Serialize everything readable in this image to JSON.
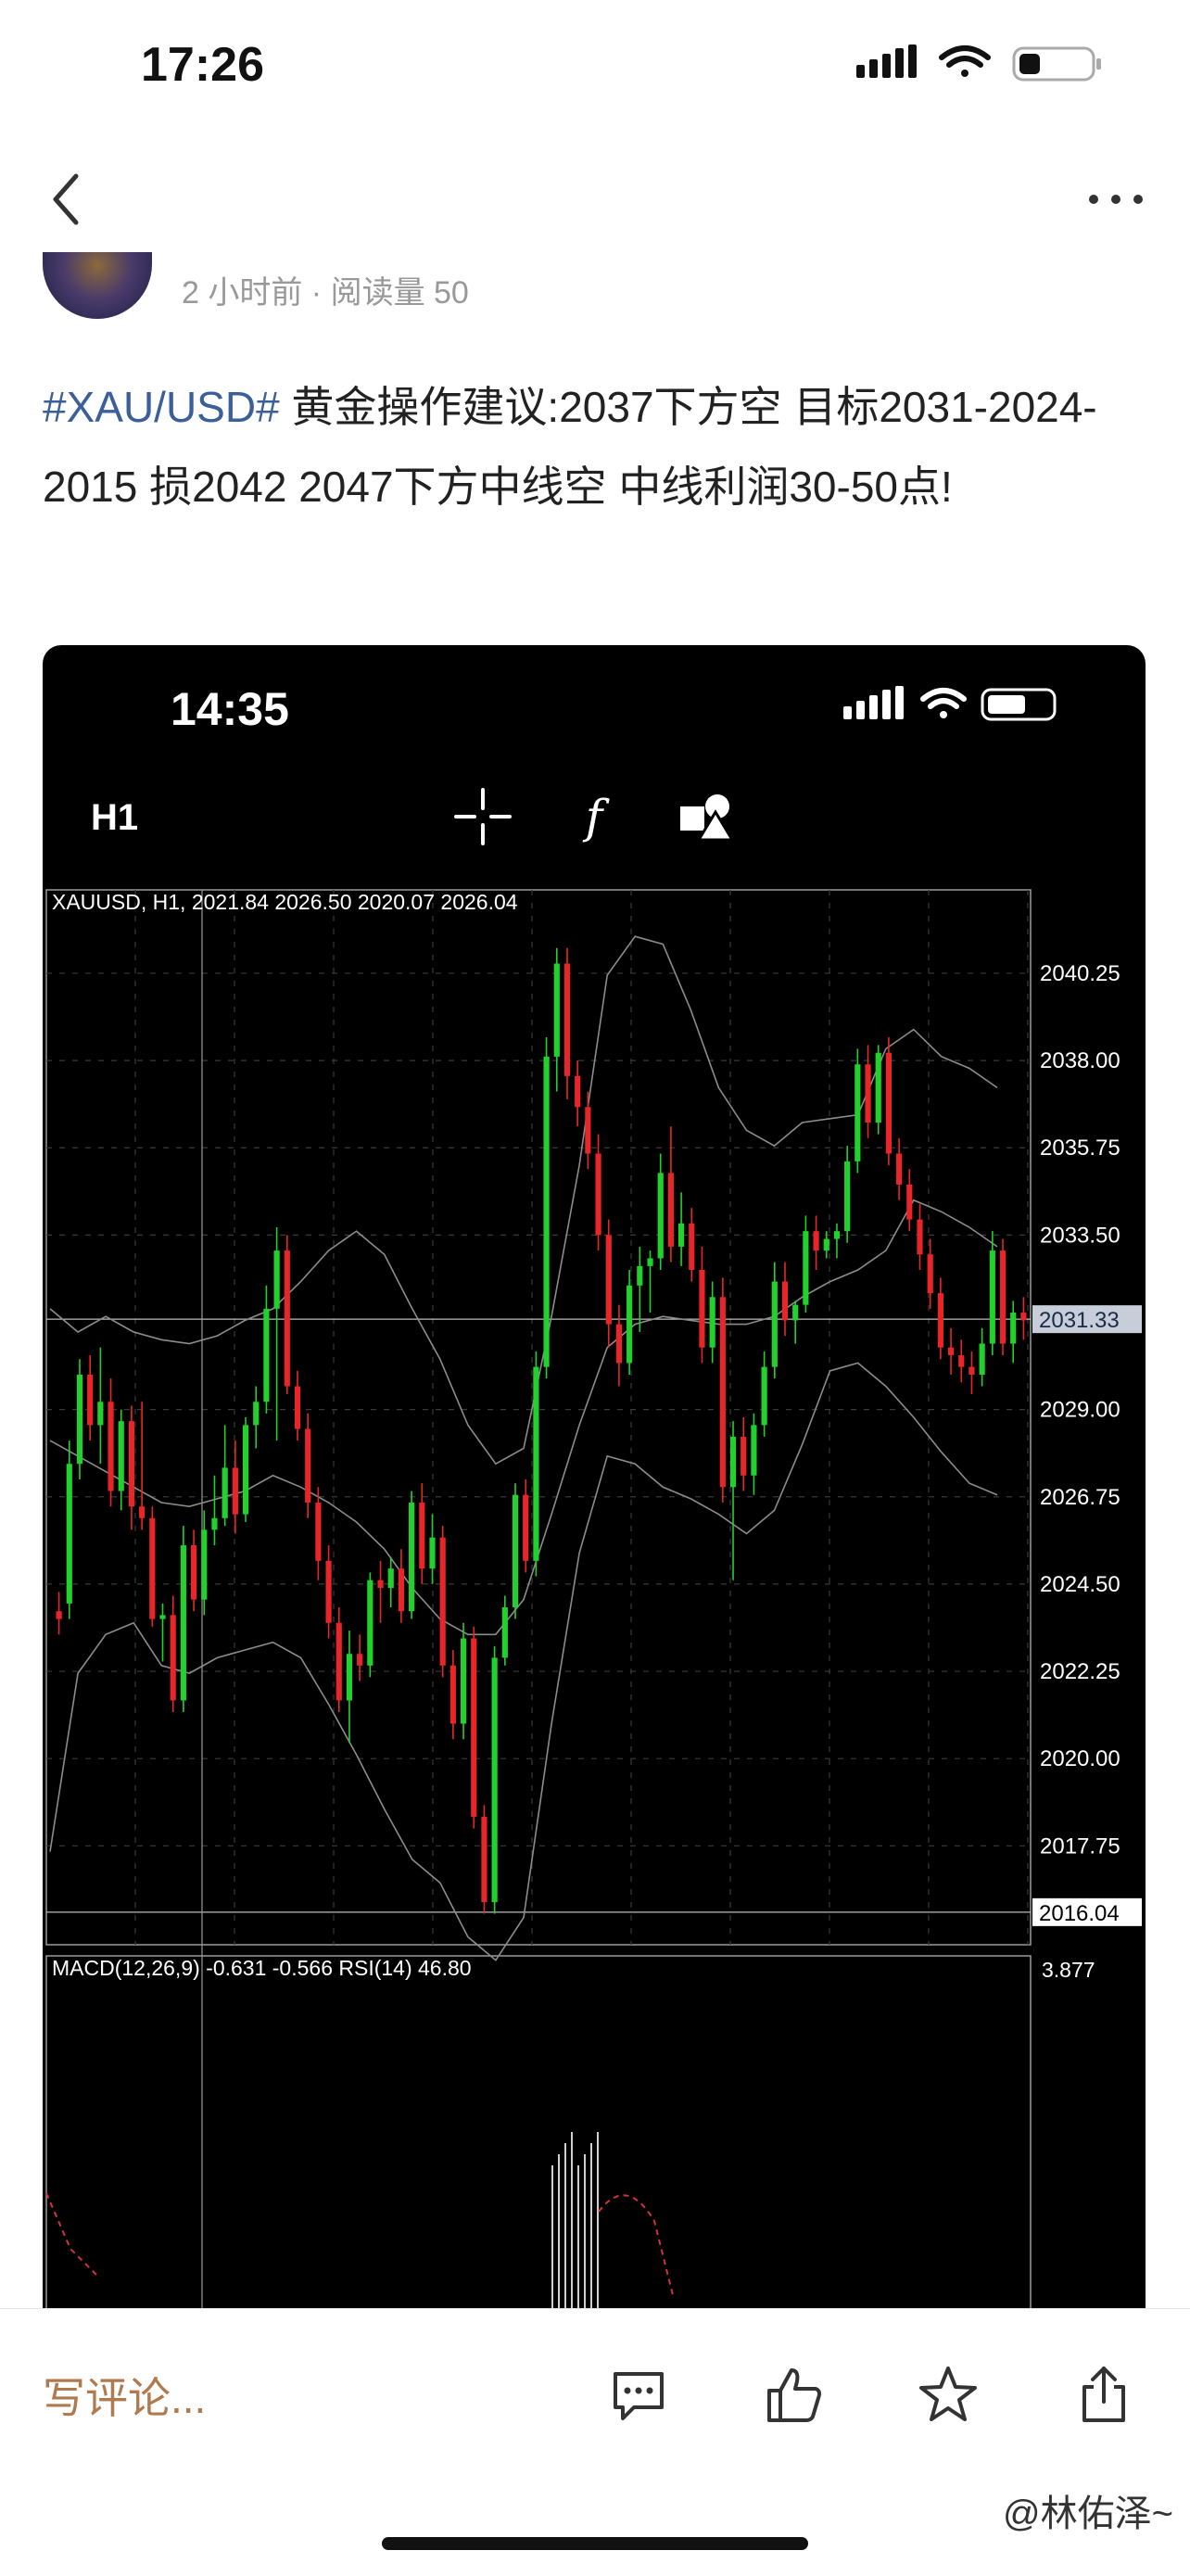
{
  "status_bar": {
    "time": "17:26"
  },
  "nav": {
    "back_icon": "chevron-left-icon",
    "more_icon": "more-dots-icon"
  },
  "post": {
    "meta": "2 小时前 · 阅读量 50",
    "hashtag": "#XAU/USD#",
    "body": " 黄金操作建议:2037下方空 目标2031-2024-2015 损2042  2047下方中线空 中线利润30-50点!"
  },
  "chart_screenshot": {
    "status_time": "14:35",
    "timeframe": "H1",
    "toolbar_icons": [
      "crosshair-icon",
      "function-icon",
      "shapes-icon"
    ],
    "price_header": "XAUUSD, H1, 2021.84 2026.50 2020.07 2026.04",
    "indicator_header": "MACD(12,26,9) -0.631 -0.566 RSI(14) 46.80",
    "indicator_axis_label": "3.877",
    "current_price_label": "2031.33",
    "low_price_label": "2016.04",
    "colors": {
      "bull": "#22d12e",
      "bear": "#e8262a",
      "grid": "#3a3a3a",
      "bands": "#8c8c8c"
    }
  },
  "chart_data": {
    "type": "candlestick",
    "title": "XAUUSD, H1",
    "ylim": [
      2015.2,
      2042.4
    ],
    "y_ticks": [
      "2040.25",
      "2038.00",
      "2035.75",
      "2033.50",
      "2029.00",
      "2026.75",
      "2024.50",
      "2022.25",
      "2020.00",
      "2017.75"
    ],
    "candles_ohlc": [
      [
        2023.8,
        2024.3,
        2023.2,
        2023.6
      ],
      [
        2024.0,
        2028.2,
        2023.6,
        2027.6
      ],
      [
        2027.6,
        2030.3,
        2027.2,
        2029.9
      ],
      [
        2029.9,
        2030.4,
        2028.2,
        2028.6
      ],
      [
        2028.6,
        2030.6,
        2027.6,
        2029.2
      ],
      [
        2029.2,
        2029.8,
        2026.5,
        2026.9
      ],
      [
        2026.9,
        2029.0,
        2026.4,
        2028.7
      ],
      [
        2028.7,
        2029.1,
        2025.9,
        2026.5
      ],
      [
        2026.5,
        2029.2,
        2025.9,
        2026.2
      ],
      [
        2026.2,
        2026.5,
        2023.4,
        2023.6
      ],
      [
        2023.6,
        2024.0,
        2022.5,
        2023.7
      ],
      [
        2023.7,
        2024.2,
        2021.2,
        2021.5
      ],
      [
        2021.5,
        2026.0,
        2021.2,
        2025.5
      ],
      [
        2025.5,
        2025.9,
        2023.8,
        2024.1
      ],
      [
        2024.1,
        2026.4,
        2023.7,
        2025.9
      ],
      [
        2025.9,
        2027.3,
        2025.5,
        2026.2
      ],
      [
        2026.2,
        2028.6,
        2026.0,
        2027.5
      ],
      [
        2027.5,
        2028.2,
        2025.8,
        2026.3
      ],
      [
        2026.3,
        2028.8,
        2026.1,
        2028.6
      ],
      [
        2028.6,
        2029.6,
        2028.0,
        2029.2
      ],
      [
        2029.2,
        2032.2,
        2028.9,
        2031.6
      ],
      [
        2031.6,
        2033.7,
        2028.2,
        2033.1
      ],
      [
        2033.1,
        2033.5,
        2029.4,
        2029.6
      ],
      [
        2029.6,
        2030.0,
        2028.2,
        2028.5
      ],
      [
        2028.5,
        2028.9,
        2026.2,
        2026.6
      ],
      [
        2026.6,
        2027.0,
        2024.6,
        2025.1
      ],
      [
        2025.1,
        2025.5,
        2023.1,
        2023.5
      ],
      [
        2023.5,
        2023.9,
        2021.2,
        2021.5
      ],
      [
        2021.5,
        2023.3,
        2020.4,
        2022.7
      ],
      [
        2022.7,
        2023.2,
        2022.0,
        2022.4
      ],
      [
        2022.4,
        2024.8,
        2022.1,
        2024.6
      ],
      [
        2024.6,
        2025.1,
        2023.5,
        2024.4
      ],
      [
        2024.4,
        2025.2,
        2023.9,
        2024.9
      ],
      [
        2024.9,
        2025.4,
        2023.5,
        2023.8
      ],
      [
        2023.8,
        2026.9,
        2023.6,
        2026.6
      ],
      [
        2026.6,
        2027.1,
        2024.5,
        2024.9
      ],
      [
        2024.9,
        2026.3,
        2024.5,
        2025.7
      ],
      [
        2025.7,
        2026.0,
        2022.1,
        2022.4
      ],
      [
        2022.4,
        2022.8,
        2020.5,
        2020.9
      ],
      [
        2020.9,
        2023.5,
        2020.5,
        2023.1
      ],
      [
        2023.1,
        2023.4,
        2018.2,
        2018.5
      ],
      [
        2018.5,
        2018.8,
        2016.0,
        2016.3
      ],
      [
        2016.3,
        2022.9,
        2016.0,
        2022.6
      ],
      [
        2022.6,
        2024.2,
        2022.4,
        2023.9
      ],
      [
        2023.9,
        2027.1,
        2023.6,
        2026.8
      ],
      [
        2026.8,
        2027.2,
        2024.8,
        2025.1
      ],
      [
        2025.1,
        2030.5,
        2024.7,
        2030.1
      ],
      [
        2030.1,
        2038.6,
        2029.8,
        2038.1
      ],
      [
        2038.1,
        2040.9,
        2037.2,
        2040.5
      ],
      [
        2040.5,
        2040.9,
        2037.0,
        2037.6
      ],
      [
        2037.6,
        2038.0,
        2036.3,
        2036.8
      ],
      [
        2036.8,
        2037.2,
        2035.2,
        2035.6
      ],
      [
        2035.6,
        2036.1,
        2033.1,
        2033.5
      ],
      [
        2033.5,
        2033.9,
        2030.6,
        2031.2
      ],
      [
        2031.2,
        2031.7,
        2029.6,
        2030.2
      ],
      [
        2030.2,
        2032.6,
        2029.9,
        2032.2
      ],
      [
        2032.2,
        2033.2,
        2031.0,
        2032.7
      ],
      [
        2032.7,
        2033.1,
        2031.5,
        2032.9
      ],
      [
        2032.9,
        2035.6,
        2032.6,
        2035.1
      ],
      [
        2035.1,
        2036.3,
        2032.8,
        2033.2
      ],
      [
        2033.2,
        2034.6,
        2032.7,
        2033.8
      ],
      [
        2033.8,
        2034.2,
        2032.3,
        2032.6
      ],
      [
        2032.6,
        2033.2,
        2030.2,
        2030.6
      ],
      [
        2030.6,
        2032.3,
        2030.2,
        2031.9
      ],
      [
        2031.9,
        2032.4,
        2026.6,
        2027.0
      ],
      [
        2027.0,
        2028.7,
        2024.6,
        2028.3
      ],
      [
        2028.3,
        2028.8,
        2026.9,
        2027.3
      ],
      [
        2027.3,
        2028.9,
        2026.8,
        2028.6
      ],
      [
        2028.6,
        2030.5,
        2028.3,
        2030.1
      ],
      [
        2030.1,
        2032.8,
        2029.8,
        2032.3
      ],
      [
        2032.3,
        2032.8,
        2030.9,
        2031.3
      ],
      [
        2031.3,
        2031.8,
        2030.7,
        2031.7
      ],
      [
        2031.7,
        2034.0,
        2031.5,
        2033.6
      ],
      [
        2033.6,
        2034.0,
        2032.6,
        2033.1
      ],
      [
        2033.1,
        2033.6,
        2032.9,
        2033.4
      ],
      [
        2033.4,
        2033.8,
        2032.9,
        2033.6
      ],
      [
        2033.6,
        2035.8,
        2033.3,
        2035.4
      ],
      [
        2035.4,
        2038.3,
        2035.1,
        2037.9
      ],
      [
        2037.9,
        2038.4,
        2036.0,
        2036.4
      ],
      [
        2036.4,
        2038.4,
        2036.1,
        2038.2
      ],
      [
        2038.2,
        2038.6,
        2035.3,
        2035.6
      ],
      [
        2035.6,
        2036.0,
        2034.4,
        2034.8
      ],
      [
        2034.8,
        2035.2,
        2033.6,
        2033.9
      ],
      [
        2033.9,
        2034.3,
        2032.6,
        2033.0
      ],
      [
        2033.0,
        2033.4,
        2031.6,
        2032.0
      ],
      [
        2032.0,
        2032.4,
        2030.3,
        2030.6
      ],
      [
        2030.6,
        2031.1,
        2029.9,
        2030.4
      ],
      [
        2030.4,
        2030.8,
        2029.7,
        2030.1
      ],
      [
        2030.1,
        2030.5,
        2029.4,
        2029.9
      ],
      [
        2029.9,
        2031.1,
        2029.6,
        2030.7
      ],
      [
        2030.7,
        2033.6,
        2030.4,
        2033.1
      ],
      [
        2033.1,
        2033.4,
        2030.4,
        2030.7
      ],
      [
        2030.7,
        2031.8,
        2030.2,
        2031.5
      ],
      [
        2031.5,
        2031.9,
        2030.8,
        2031.3
      ]
    ],
    "bollinger": {
      "upper": [
        2031.6,
        2031.0,
        2031.4,
        2031.0,
        2030.8,
        2030.7,
        2030.9,
        2031.3,
        2031.6,
        2032.3,
        2033.1,
        2033.6,
        2033.0,
        2031.6,
        2030.3,
        2028.6,
        2027.6,
        2028.0,
        2031.4,
        2035.3,
        2040.2,
        2041.2,
        2041.0,
        2039.3,
        2037.3,
        2036.2,
        2035.8,
        2036.4,
        2036.5,
        2036.6,
        2038.3,
        2038.8,
        2038.1,
        2037.8,
        2037.3
      ],
      "middle": [
        2028.2,
        2027.8,
        2027.4,
        2027.0,
        2026.6,
        2026.5,
        2026.7,
        2026.9,
        2027.3,
        2027.0,
        2026.6,
        2026.1,
        2025.4,
        2024.4,
        2023.6,
        2023.2,
        2023.2,
        2024.1,
        2026.3,
        2028.6,
        2030.6,
        2031.2,
        2031.4,
        2031.3,
        2031.2,
        2031.2,
        2031.4,
        2031.9,
        2032.3,
        2032.6,
        2033.1,
        2034.4,
        2034.1,
        2033.7,
        2033.2
      ],
      "lower": [
        2017.6,
        2022.2,
        2023.2,
        2023.5,
        2022.4,
        2022.2,
        2022.6,
        2022.8,
        2023.0,
        2022.6,
        2021.4,
        2020.1,
        2018.7,
        2017.4,
        2016.8,
        2015.4,
        2014.8,
        2015.9,
        2020.9,
        2025.3,
        2027.8,
        2027.6,
        2027.0,
        2026.7,
        2026.3,
        2025.8,
        2026.4,
        2028.1,
        2030.0,
        2030.2,
        2029.6,
        2028.8,
        2027.9,
        2027.1,
        2026.8
      ]
    },
    "indicator_pane": {
      "title": "MACD(12,26,9) -0.631 -0.566 RSI(14) 46.80",
      "axis_label": "3.877"
    }
  },
  "bottom_bar": {
    "comment_placeholder": "写评论...",
    "action_icons": [
      "comment-icon",
      "like-icon",
      "favorite-icon",
      "share-icon"
    ],
    "watermark": "@林佑泽~"
  }
}
